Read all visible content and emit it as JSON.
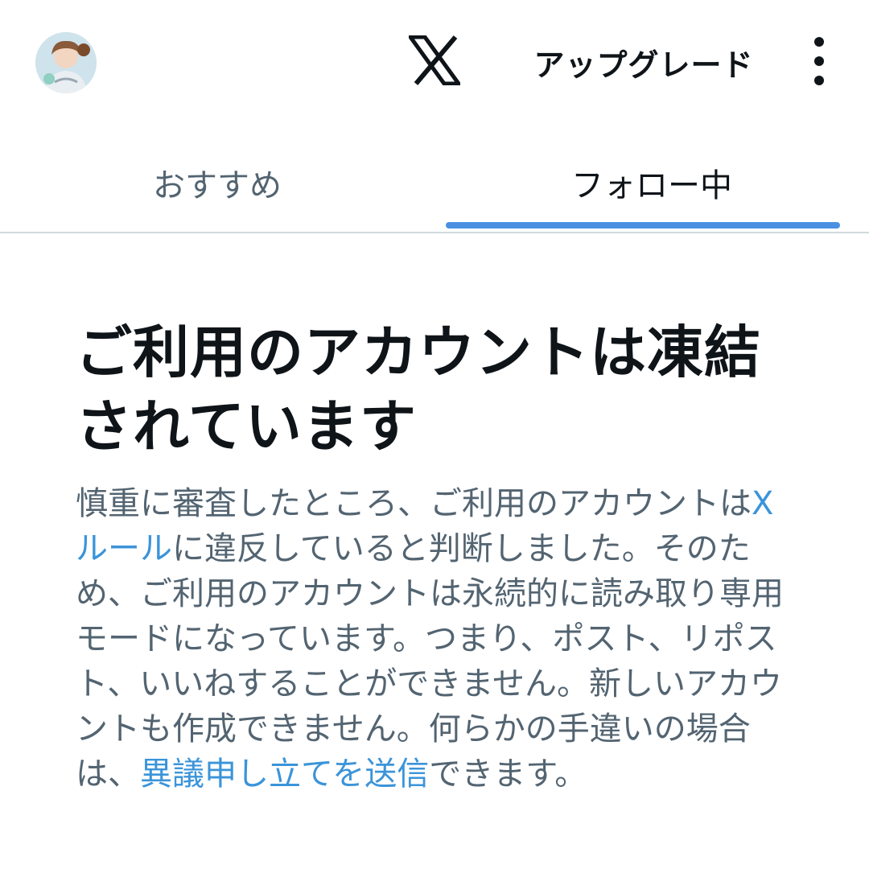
{
  "header": {
    "upgrade_label": "アップグレード"
  },
  "tabs": [
    {
      "label": "おすすめ",
      "active": false
    },
    {
      "label": "フォロー中",
      "active": true
    }
  ],
  "notice": {
    "title": "ご利用のアカウントは凍結されています",
    "body_part1": "慎重に審査したところ、ご利用のアカウントは",
    "rules_link": "Xルール",
    "body_part2": "に違反していると判断しました。そのため、ご利用のアカウントは永続的に読み取り専用モードになっています。つまり、ポスト、リポスト、いいねすることができません。新しいアカウントも作成できません。何らかの手違いの場合は、",
    "appeal_link": "異議申し立てを送信",
    "body_part3": "できます。"
  },
  "colors": {
    "accent": "#4a90e2",
    "link": "#3b94d9",
    "text_primary": "#0f1419",
    "text_secondary": "#536471",
    "divider": "#cfd9de"
  },
  "icons": {
    "avatar": "user-avatar",
    "logo": "x-logo-icon",
    "more": "more-vertical-icon"
  }
}
